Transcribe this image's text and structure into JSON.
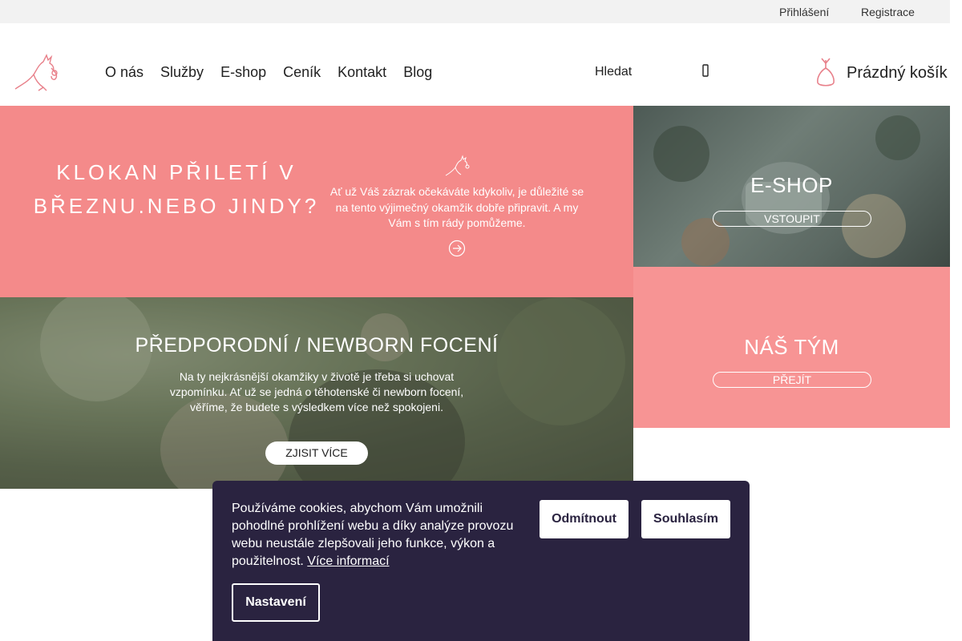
{
  "topbar": {
    "login": "Přihlášení",
    "register": "Registrace"
  },
  "header": {
    "nav": [
      "O nás",
      "Služby",
      "E-shop",
      "Ceník",
      "Kontakt",
      "Blog"
    ],
    "search_label": "Hledat",
    "cart_label": "Prázdný košík"
  },
  "hero": {
    "title": "KLOKAN PŘILETÍ V BŘEZNU.NEBO JINDY?",
    "text": "Ať už Váš zázrak očekáváte kdykoliv, je důležité se na tento výjimečný okamžik dobře připravit. A my Vám s tím rády pomůžeme."
  },
  "eshop_tile": {
    "title": "E-SHOP",
    "button": "VSTOUPIT"
  },
  "team_tile": {
    "title": "NÁŠ TÝM",
    "button": "PŘEJÍT"
  },
  "newborn": {
    "title": "PŘEDPORODNÍ / NEWBORN FOCENÍ",
    "text": "Na ty nejkrásnější okamžiky v životě je třeba si uchovat vzpomínku. Ať už se jedná o těhotenské či newborn focení, věříme, že budete s výsledkem více než spokojeni.",
    "button": "ZJISIT VÍCE"
  },
  "cookie": {
    "text": "Používáme cookies, abychom Vám umožnili pohodlné prohlížení webu a díky analýze provozu webu neustále zlepšovali jeho funkce, výkon a použitelnost.",
    "more_link": "Více informací",
    "decline": "Odmítnout",
    "accept": "Souhlasím",
    "settings": "Nastavení"
  },
  "colors": {
    "accent_pink": "#f48a8a",
    "team_pink": "#f79494",
    "cookie_bg": "#2a2340"
  },
  "icons": [
    "kangaroo-logo-icon",
    "search-icon",
    "cart-bag-icon",
    "kangaroo-mini-icon",
    "arrow-right-circle-icon"
  ]
}
